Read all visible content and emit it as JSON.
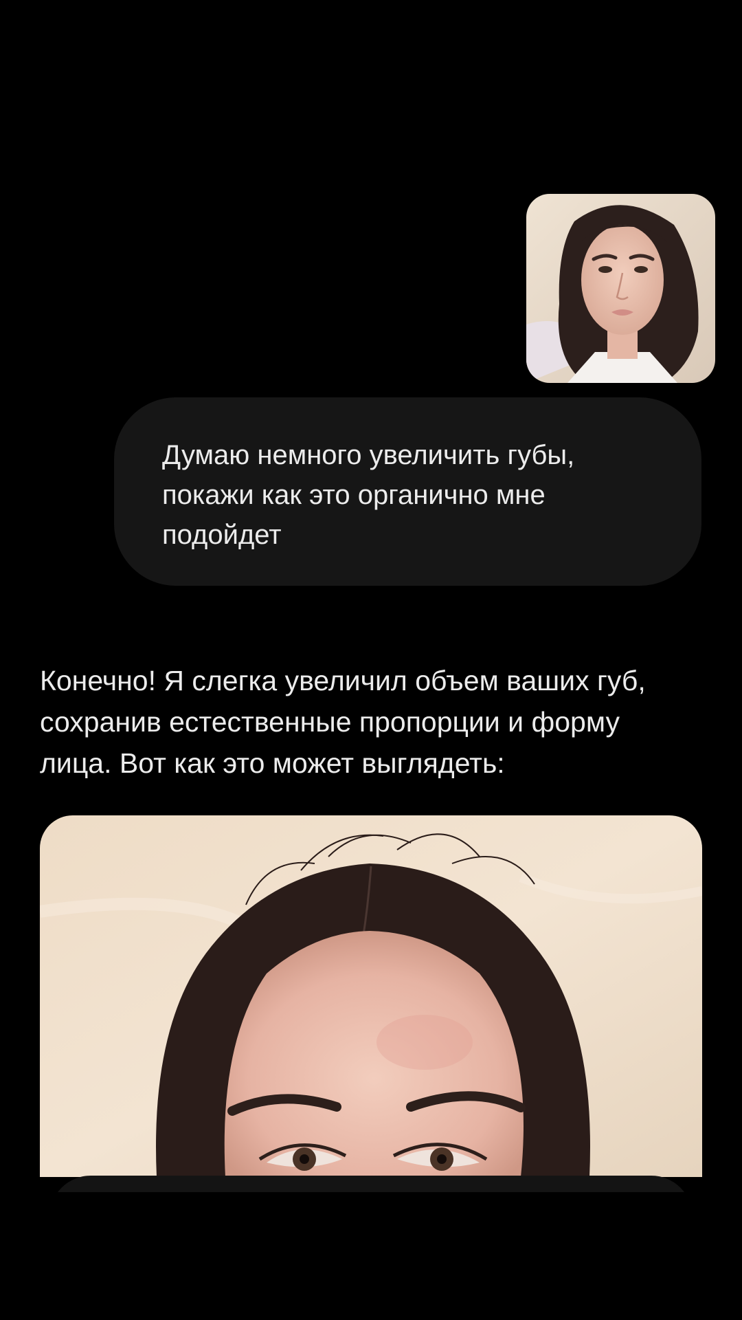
{
  "conversation": {
    "user_photo": {
      "icon": "photo-thumbnail"
    },
    "user_message": {
      "text": "Думаю немного увеличить губы,\nпокажи как это органично мне\nподойдет"
    },
    "assistant_message": {
      "text": "Конечно! Я слегка увеличил объем ваших губ,\nсохранив естественные пропорции и форму\nлица. Вот как это может выглядеть:"
    },
    "generated_image": {
      "icon": "generated-portrait"
    }
  },
  "colors": {
    "background": "#000000",
    "bubble": "#161616",
    "text": "#ececec"
  }
}
